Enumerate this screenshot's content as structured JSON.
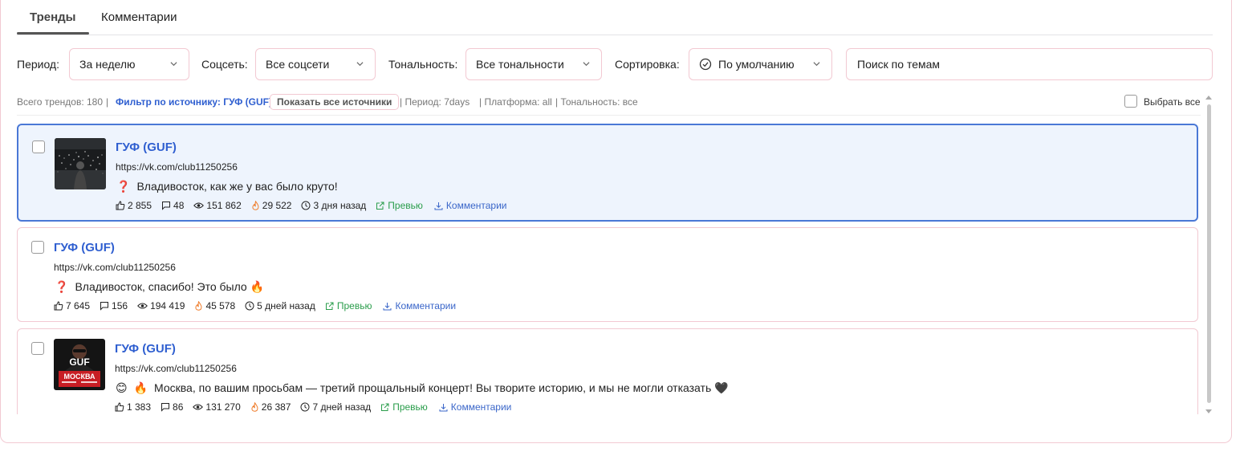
{
  "tabs": [
    {
      "label": "Тренды",
      "active": true
    },
    {
      "label": "Комментарии",
      "active": false
    }
  ],
  "filters": {
    "period_label": "Период:",
    "period_value": "За неделю",
    "network_label": "Соцсеть:",
    "network_value": "Все соцсети",
    "tone_label": "Тональность:",
    "tone_value": "Все тональности",
    "sort_label": "Сортировка:",
    "sort_value": "По умолчанию",
    "search_placeholder": "Поиск по темам"
  },
  "info": {
    "total": "Всего трендов: 180",
    "sep1": "|",
    "source_filter": "Фильтр по источнику: ГУФ (GUF)",
    "show_all": "Показать все источники",
    "period": "|  Период: 7days",
    "platform": "| Платформа: all",
    "tone": "| Тональность: все",
    "select_all": "Выбрать все"
  },
  "cards": [
    {
      "title": "ГУФ (GUF)",
      "url": "https://vk.com/club11250256",
      "emoji1": "❓",
      "text": "Владивосток, как же у вас было круто!",
      "likes": "2 855",
      "comments": "48",
      "views": "151 862",
      "heat": "29 522",
      "time": "3 дня назад",
      "preview": "Превью",
      "comments_link": "Комментарии",
      "selected": true
    },
    {
      "title": "ГУФ (GUF)",
      "url": "https://vk.com/club11250256",
      "emoji1": "❓",
      "text": "Владивосток, спасибо! Это было 🔥",
      "likes": "7 645",
      "comments": "156",
      "views": "194 419",
      "heat": "45 578",
      "time": "5 дней назад",
      "preview": "Превью",
      "comments_link": "Комментарии",
      "selected": false
    },
    {
      "title": "ГУФ (GUF)",
      "url": "https://vk.com/club11250256",
      "emoji1": "😊",
      "emoji2": "🔥",
      "text": "Москва, по вашим просьбам — третий прощальный концерт! Вы творите историю, и мы не могли отказать 🖤",
      "likes": "1 383",
      "comments": "86",
      "views": "131 270",
      "heat": "26 387",
      "time": "7 дней назад",
      "preview": "Превью",
      "comments_link": "Комментарии",
      "selected": false,
      "thumb_text_top": "GUF",
      "thumb_text_bottom": "МОСКВА"
    }
  ],
  "colors": {
    "accent_blue": "#2f5fd0",
    "border_pink": "#f2c9d2",
    "selected_bg": "#eef4fd",
    "selected_border": "#4a78d6",
    "green": "#2a9d4b",
    "fire": "#ef7d2c"
  }
}
